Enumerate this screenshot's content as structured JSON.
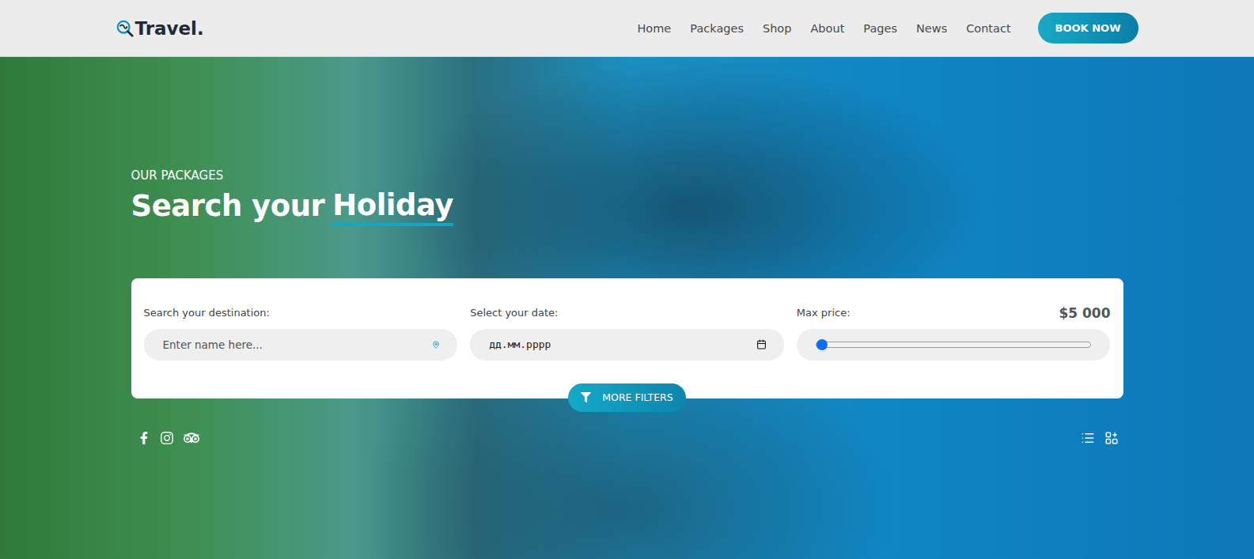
{
  "header": {
    "logo": "Travel.",
    "nav": [
      "Home",
      "Packages",
      "Shop",
      "About",
      "Pages",
      "News",
      "Contact"
    ],
    "button": "BOOK NOW"
  },
  "hero": {
    "eyebrow": "OUR PACKAGES",
    "title": "Search your",
    "highlight": "Holiday"
  },
  "search": {
    "destination": {
      "label": "Search your destination:",
      "placeholder": "Enter name here..."
    },
    "date": {
      "label": "Select your date:",
      "placeholder": "дд.мм.рррр"
    },
    "price": {
      "label": "Max price:",
      "value": "$5 000",
      "level": 0
    },
    "more_filters": "MORE FILTERS"
  }
}
